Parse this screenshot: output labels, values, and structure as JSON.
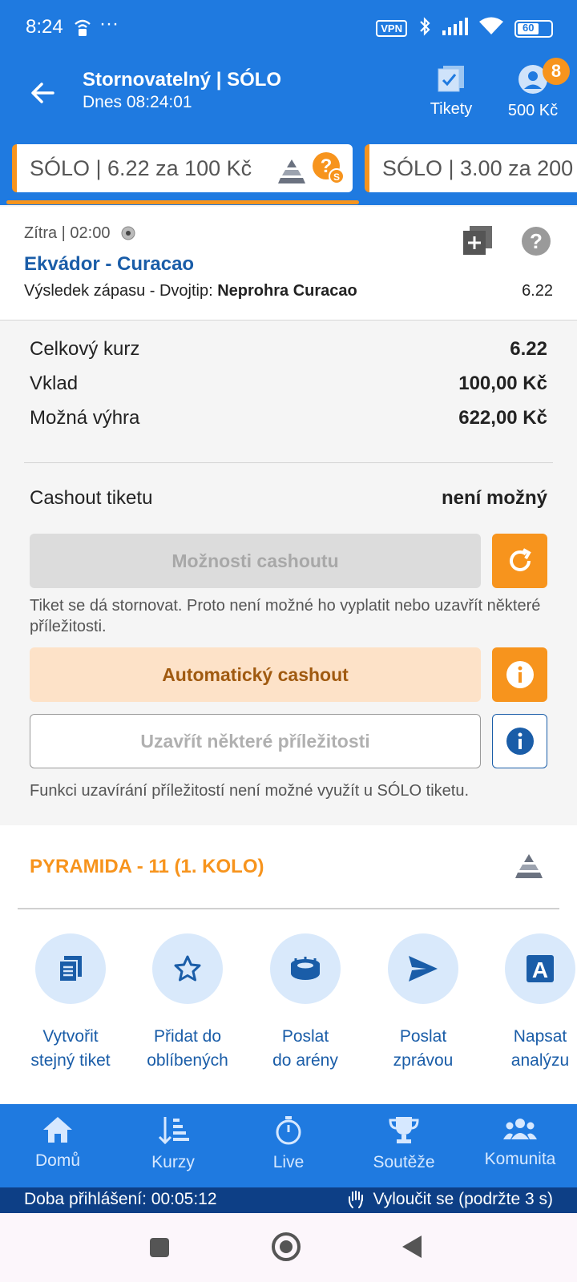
{
  "status": {
    "time": "8:24",
    "more": "···",
    "vpn": "VPN",
    "battery": "60"
  },
  "header": {
    "title": "Stornovatelný | SÓLO",
    "subtitle": "Dnes 08:24:01",
    "tickets_label": "Tikety",
    "balance": "500 Kč",
    "badge": "8"
  },
  "tabs": [
    {
      "label": "SÓLO  | 6.22 za 100 Kč"
    },
    {
      "label": "SÓLO  | 3.00 za 200"
    }
  ],
  "event": {
    "time": "Zítra  | 02:00",
    "title": "Ekvádor - Curacao",
    "market_prefix": "Výsledek zápasu - Dvojtip: ",
    "market_pick": "Neprohra Curacao",
    "odd": "6.22"
  },
  "summary": {
    "total_odds_label": "Celkový kurz",
    "total_odds": "6.22",
    "stake_label": "Vklad",
    "stake": "100,00 Kč",
    "win_label": "Možná výhra",
    "win": "622,00 Kč",
    "cashout_label": "Cashout tiketu",
    "cashout_value": "není možný",
    "cashout_options": "Možnosti cashoutu",
    "note1": "Tiket se dá stornovat. Proto není možné ho vyplatit nebo uzavřít některé příležitosti.",
    "auto_cashout": "Automatický cashout",
    "close_some": "Uzavřít některé příležitosti",
    "note2": "Funkci uzavírání příležitostí není možné využít u SÓLO tiketu."
  },
  "pyramid": {
    "title": "PYRAMIDA - 11 (1. KOLO)"
  },
  "actions": [
    {
      "line1": "Vytvořit",
      "line2": "stejný tiket"
    },
    {
      "line1": "Přidat do",
      "line2": "oblíbených"
    },
    {
      "line1": "Poslat",
      "line2": "do arény"
    },
    {
      "line1": "Poslat",
      "line2": "zprávou"
    },
    {
      "line1": "Napsat",
      "line2": "analýzu"
    }
  ],
  "nav": [
    {
      "label": "Domů"
    },
    {
      "label": "Kurzy"
    },
    {
      "label": "Live"
    },
    {
      "label": "Soutěže"
    },
    {
      "label": "Komunita"
    }
  ],
  "login": {
    "duration": "Doba přihlášení: 00:05:12",
    "exclude": "Vyloučit se (podržte 3 s)"
  },
  "colors": {
    "brand_blue": "#1f7ae0",
    "accent_orange": "#f7941d",
    "dark_blue": "#0d3f86"
  }
}
